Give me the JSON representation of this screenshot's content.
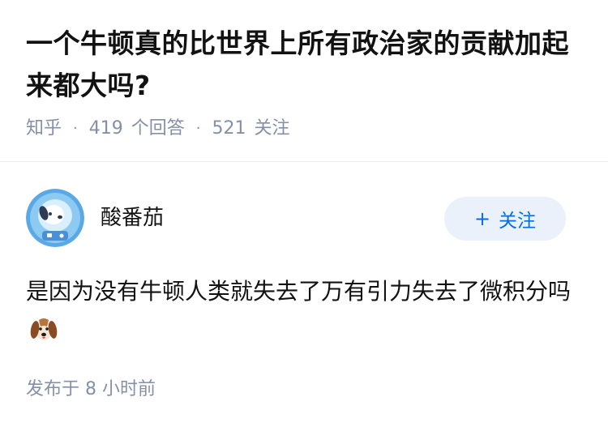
{
  "question": {
    "title": "一个牛顿真的比世界上所有政治家的贡献加起来都大吗?",
    "source": "知乎",
    "answer_count": "419",
    "answer_label": "个回答",
    "follower_count": "521",
    "follower_label": "关注"
  },
  "answer": {
    "author_name": "酸番茄",
    "follow_label": "关注",
    "follow_plus": "+",
    "content": "是因为没有牛顿人类就失去了万有引力失去了微积分吗",
    "emoji": "dog-face-emoji",
    "time": "发布于  8 小时前"
  },
  "colors": {
    "accent": "#056de8",
    "follow_bg": "#ebf1fb",
    "meta_text": "#8590a6",
    "avatar_bg": "#5aa9e6"
  }
}
